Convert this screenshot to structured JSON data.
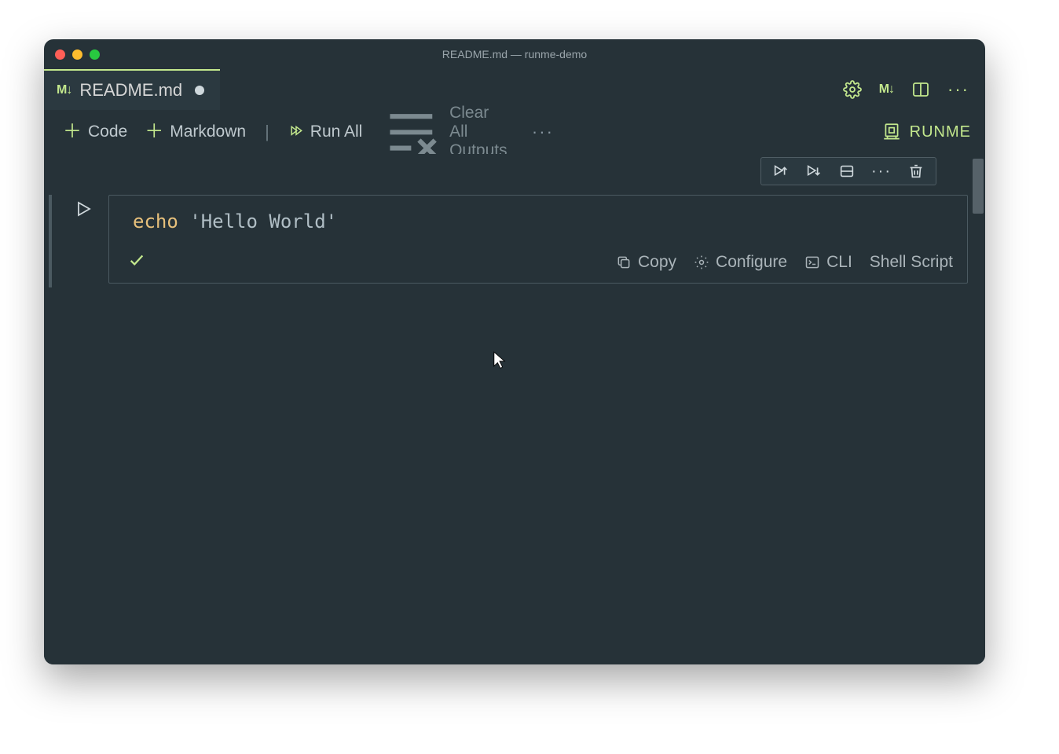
{
  "window": {
    "title": "README.md — runme-demo"
  },
  "tab": {
    "icon_label": "M↓",
    "filename": "README.md",
    "dirty": true
  },
  "tabbar_actions": {
    "markdown_icon_label": "M↓"
  },
  "toolbar": {
    "code_label": "Code",
    "markdown_label": "Markdown",
    "run_all_label": "Run All",
    "clear_outputs_label": "Clear All Outputs",
    "runme_label": "RUNME"
  },
  "cell": {
    "code_cmd": "echo",
    "code_str": " 'Hello World'",
    "footer": {
      "copy_label": "Copy",
      "configure_label": "Configure",
      "cli_label": "CLI",
      "language_label": "Shell Script"
    }
  }
}
